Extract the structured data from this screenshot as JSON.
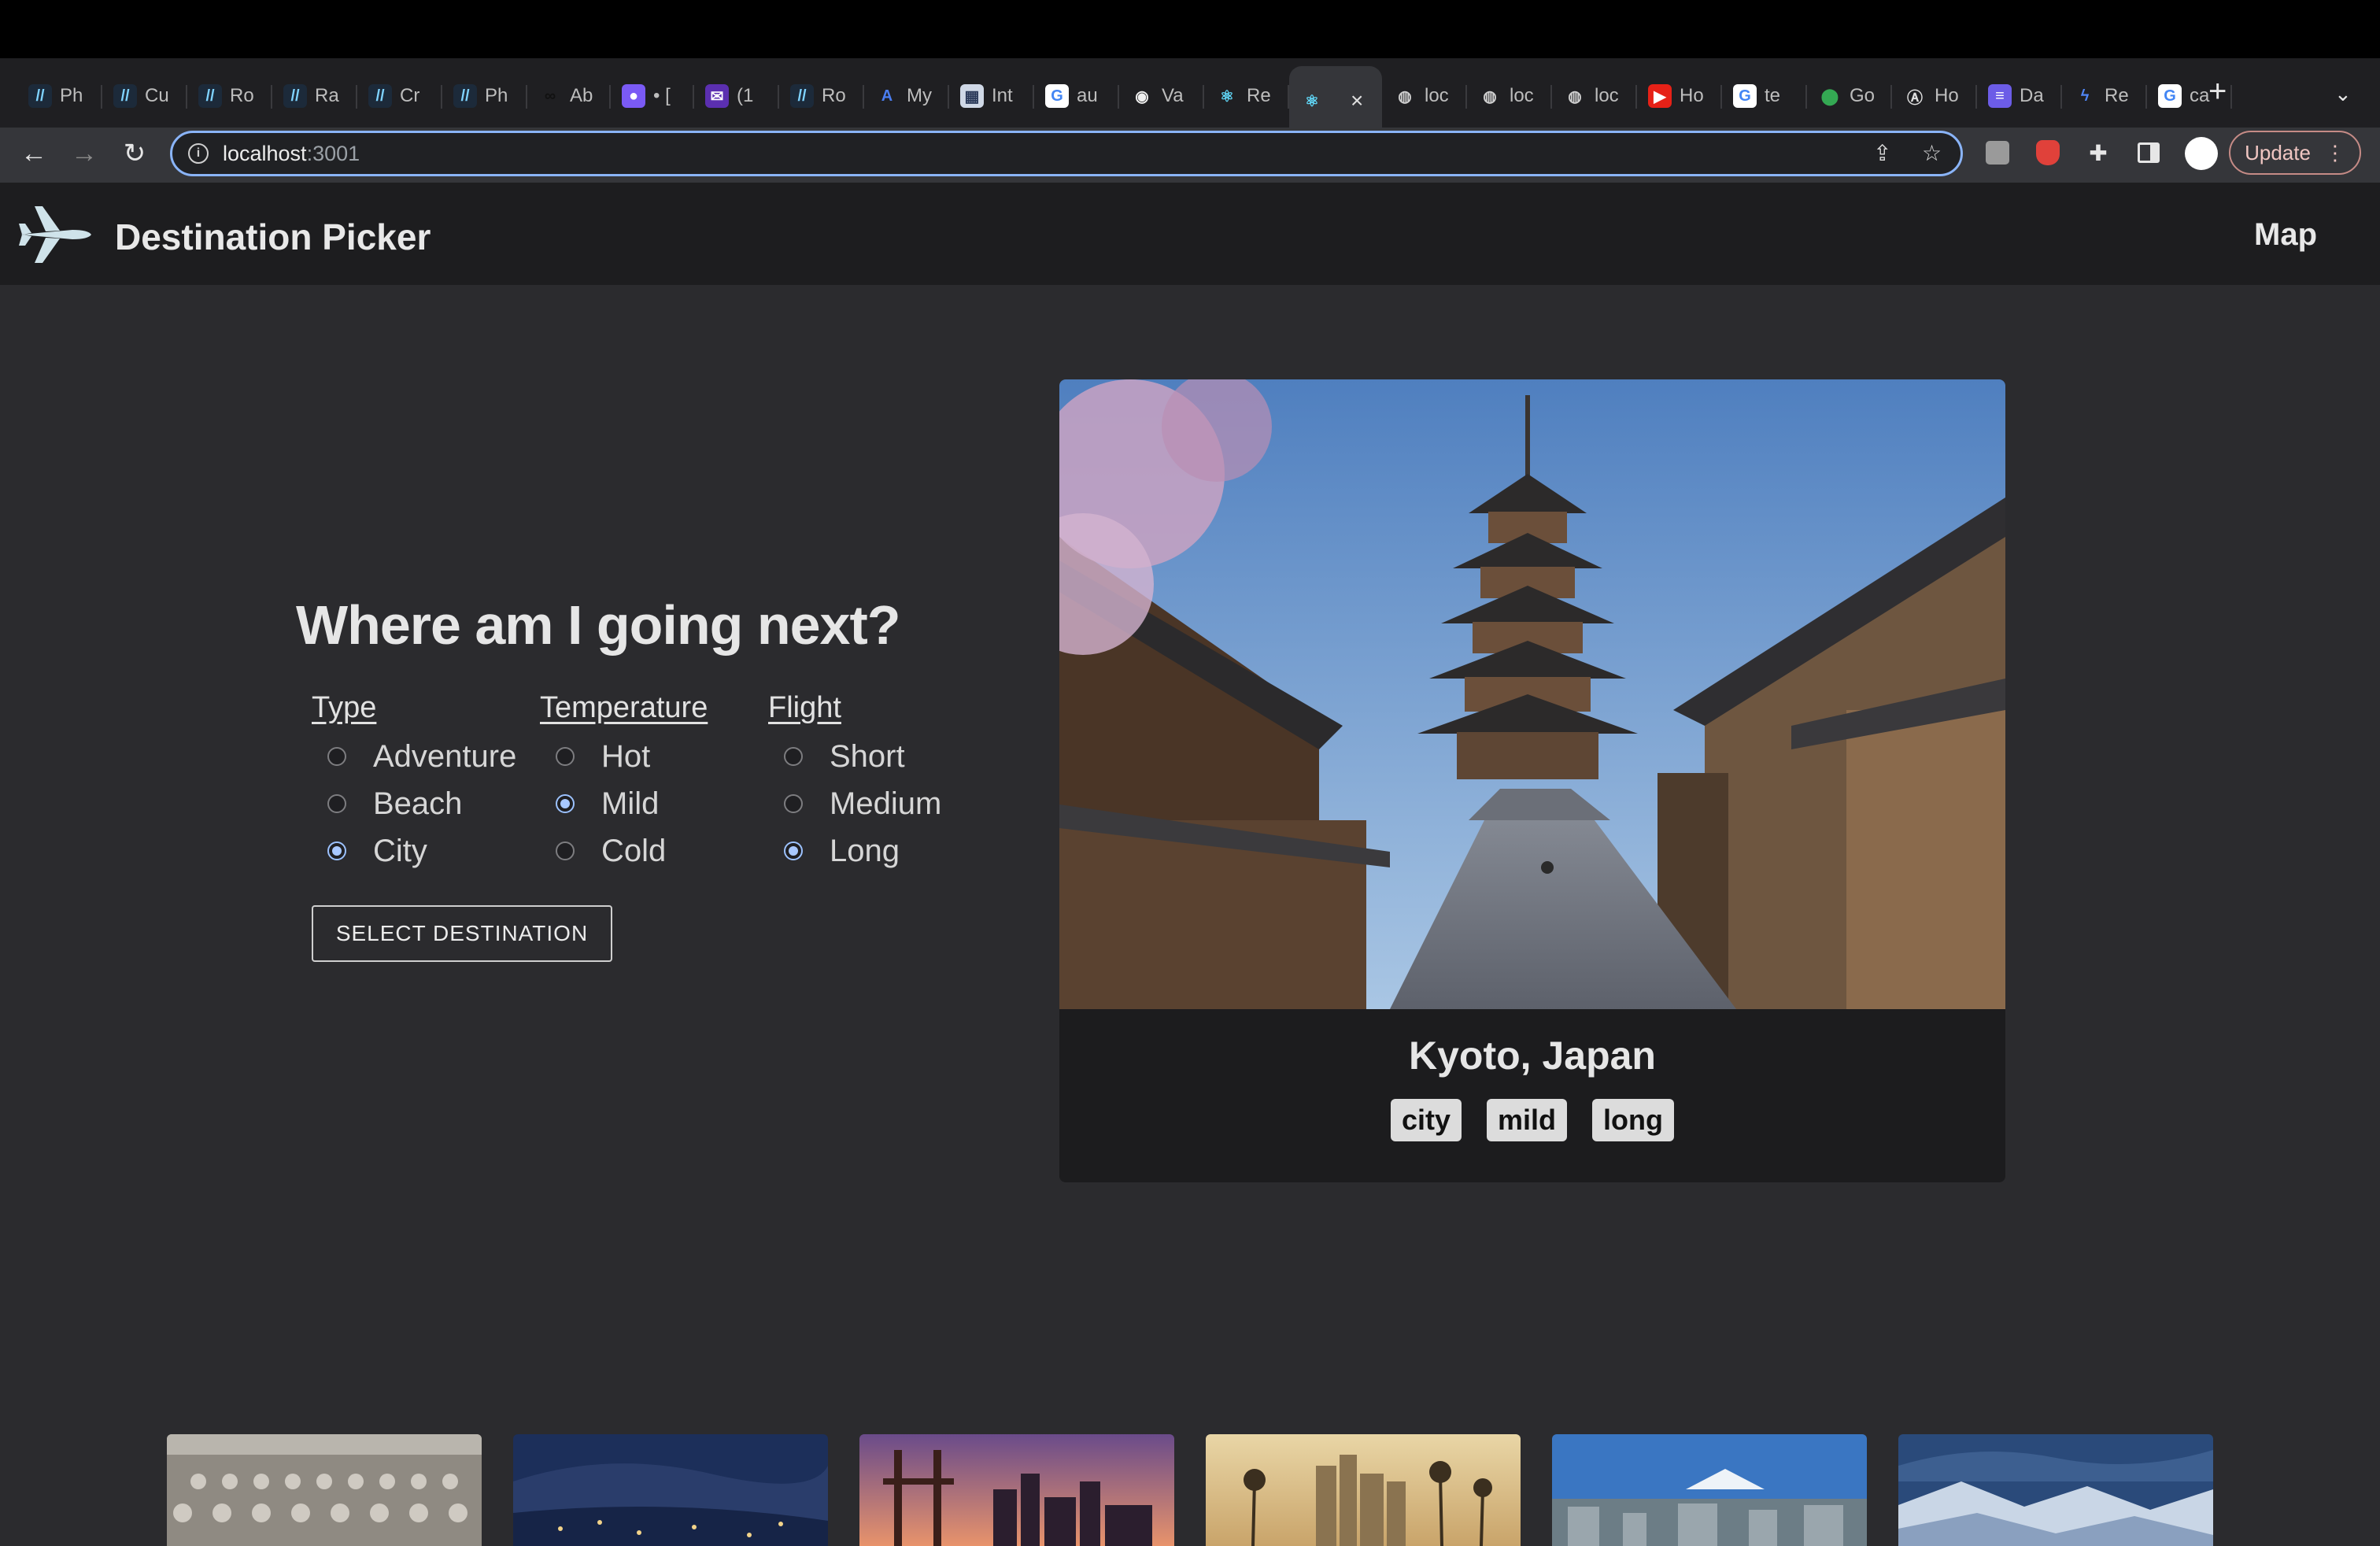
{
  "browser": {
    "tabs": [
      {
        "label": "Ph",
        "icon": "slashes-icon"
      },
      {
        "label": "Cu",
        "icon": "slashes-icon"
      },
      {
        "label": "Ro",
        "icon": "slashes-icon"
      },
      {
        "label": "Ra",
        "icon": "slashes-icon"
      },
      {
        "label": "Cr",
        "icon": "slashes-icon"
      },
      {
        "label": "Ph",
        "icon": "slashes-icon"
      },
      {
        "label": "Ab",
        "icon": "infinity-icon"
      },
      {
        "label": "• [",
        "icon": "chrome-icon"
      },
      {
        "label": "(1",
        "icon": "mail-icon"
      },
      {
        "label": "Ro",
        "icon": "slashes-icon"
      },
      {
        "label": "My",
        "icon": "letter-a-icon"
      },
      {
        "label": "Int",
        "icon": "image-icon"
      },
      {
        "label": "au",
        "icon": "google-icon"
      },
      {
        "label": "Va",
        "icon": "github-icon"
      },
      {
        "label": "Re",
        "icon": "react-icon"
      },
      {
        "label": "",
        "icon": "react-icon"
      },
      {
        "label": "loc",
        "icon": "globe-icon"
      },
      {
        "label": "loc",
        "icon": "globe-icon"
      },
      {
        "label": "loc",
        "icon": "globe-icon"
      },
      {
        "label": "Ho",
        "icon": "youtube-icon"
      },
      {
        "label": "te",
        "icon": "google-icon"
      },
      {
        "label": "Go",
        "icon": "maps-pin-icon"
      },
      {
        "label": "Ho",
        "icon": "circle-a-icon"
      },
      {
        "label": "Da",
        "icon": "list-icon"
      },
      {
        "label": "Re",
        "icon": "bolt-icon"
      },
      {
        "label": "ca",
        "icon": "google-icon"
      }
    ],
    "active_tab_index": 15,
    "url_host": "localhost",
    "url_port": ":3001",
    "update_label": "Update"
  },
  "header": {
    "title": "Destination Picker",
    "nav_link": "Map"
  },
  "picker": {
    "heading": "Where am I going next?",
    "groups": [
      {
        "title": "Type",
        "options": [
          "Adventure",
          "Beach",
          "City"
        ],
        "selected": "City"
      },
      {
        "title": "Temperature",
        "options": [
          "Hot",
          "Mild",
          "Cold"
        ],
        "selected": "Mild"
      },
      {
        "title": "Flight",
        "options": [
          "Short",
          "Medium",
          "Long"
        ],
        "selected": "Long"
      }
    ],
    "button_label": "SELECT DESTINATION"
  },
  "destination": {
    "name": "Kyoto, Japan",
    "tags": [
      "city",
      "mild",
      "long"
    ]
  },
  "thumbnails": [
    {
      "name": "terracotta-army-thumbnail"
    },
    {
      "name": "night-mountain-town-thumbnail"
    },
    {
      "name": "san-francisco-thumbnail"
    },
    {
      "name": "los-angeles-thumbnail"
    },
    {
      "name": "mountain-city-thumbnail"
    },
    {
      "name": "snowy-mountains-thumbnail"
    }
  ],
  "colors": {
    "background": "#2b2b2e",
    "header_bg": "#1d1d1f",
    "card_bg": "#1c1c1e",
    "accent_radio": "#a8c8ff",
    "tag_bg": "#dcdcdc"
  }
}
